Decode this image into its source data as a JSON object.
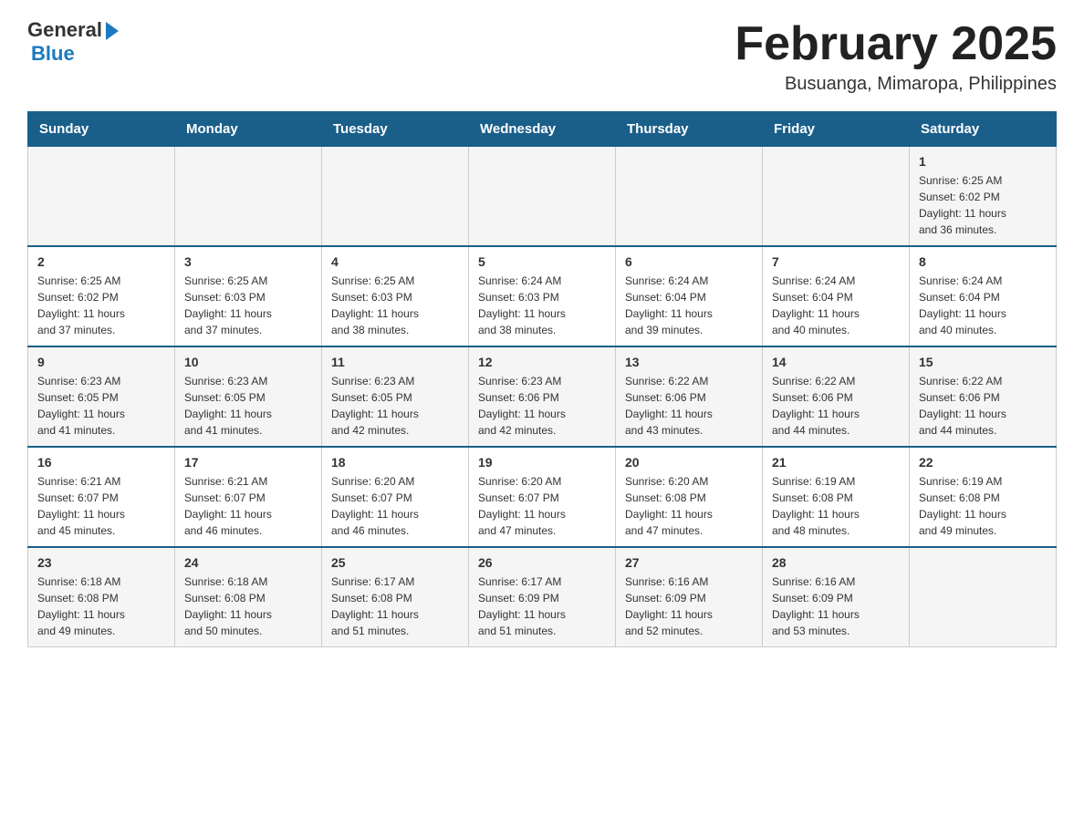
{
  "header": {
    "logo_general": "General",
    "logo_blue": "Blue",
    "month_title": "February 2025",
    "location": "Busuanga, Mimaropa, Philippines"
  },
  "weekdays": [
    "Sunday",
    "Monday",
    "Tuesday",
    "Wednesday",
    "Thursday",
    "Friday",
    "Saturday"
  ],
  "weeks": [
    [
      {
        "day": "",
        "info": ""
      },
      {
        "day": "",
        "info": ""
      },
      {
        "day": "",
        "info": ""
      },
      {
        "day": "",
        "info": ""
      },
      {
        "day": "",
        "info": ""
      },
      {
        "day": "",
        "info": ""
      },
      {
        "day": "1",
        "info": "Sunrise: 6:25 AM\nSunset: 6:02 PM\nDaylight: 11 hours\nand 36 minutes."
      }
    ],
    [
      {
        "day": "2",
        "info": "Sunrise: 6:25 AM\nSunset: 6:02 PM\nDaylight: 11 hours\nand 37 minutes."
      },
      {
        "day": "3",
        "info": "Sunrise: 6:25 AM\nSunset: 6:03 PM\nDaylight: 11 hours\nand 37 minutes."
      },
      {
        "day": "4",
        "info": "Sunrise: 6:25 AM\nSunset: 6:03 PM\nDaylight: 11 hours\nand 38 minutes."
      },
      {
        "day": "5",
        "info": "Sunrise: 6:24 AM\nSunset: 6:03 PM\nDaylight: 11 hours\nand 38 minutes."
      },
      {
        "day": "6",
        "info": "Sunrise: 6:24 AM\nSunset: 6:04 PM\nDaylight: 11 hours\nand 39 minutes."
      },
      {
        "day": "7",
        "info": "Sunrise: 6:24 AM\nSunset: 6:04 PM\nDaylight: 11 hours\nand 40 minutes."
      },
      {
        "day": "8",
        "info": "Sunrise: 6:24 AM\nSunset: 6:04 PM\nDaylight: 11 hours\nand 40 minutes."
      }
    ],
    [
      {
        "day": "9",
        "info": "Sunrise: 6:23 AM\nSunset: 6:05 PM\nDaylight: 11 hours\nand 41 minutes."
      },
      {
        "day": "10",
        "info": "Sunrise: 6:23 AM\nSunset: 6:05 PM\nDaylight: 11 hours\nand 41 minutes."
      },
      {
        "day": "11",
        "info": "Sunrise: 6:23 AM\nSunset: 6:05 PM\nDaylight: 11 hours\nand 42 minutes."
      },
      {
        "day": "12",
        "info": "Sunrise: 6:23 AM\nSunset: 6:06 PM\nDaylight: 11 hours\nand 42 minutes."
      },
      {
        "day": "13",
        "info": "Sunrise: 6:22 AM\nSunset: 6:06 PM\nDaylight: 11 hours\nand 43 minutes."
      },
      {
        "day": "14",
        "info": "Sunrise: 6:22 AM\nSunset: 6:06 PM\nDaylight: 11 hours\nand 44 minutes."
      },
      {
        "day": "15",
        "info": "Sunrise: 6:22 AM\nSunset: 6:06 PM\nDaylight: 11 hours\nand 44 minutes."
      }
    ],
    [
      {
        "day": "16",
        "info": "Sunrise: 6:21 AM\nSunset: 6:07 PM\nDaylight: 11 hours\nand 45 minutes."
      },
      {
        "day": "17",
        "info": "Sunrise: 6:21 AM\nSunset: 6:07 PM\nDaylight: 11 hours\nand 46 minutes."
      },
      {
        "day": "18",
        "info": "Sunrise: 6:20 AM\nSunset: 6:07 PM\nDaylight: 11 hours\nand 46 minutes."
      },
      {
        "day": "19",
        "info": "Sunrise: 6:20 AM\nSunset: 6:07 PM\nDaylight: 11 hours\nand 47 minutes."
      },
      {
        "day": "20",
        "info": "Sunrise: 6:20 AM\nSunset: 6:08 PM\nDaylight: 11 hours\nand 47 minutes."
      },
      {
        "day": "21",
        "info": "Sunrise: 6:19 AM\nSunset: 6:08 PM\nDaylight: 11 hours\nand 48 minutes."
      },
      {
        "day": "22",
        "info": "Sunrise: 6:19 AM\nSunset: 6:08 PM\nDaylight: 11 hours\nand 49 minutes."
      }
    ],
    [
      {
        "day": "23",
        "info": "Sunrise: 6:18 AM\nSunset: 6:08 PM\nDaylight: 11 hours\nand 49 minutes."
      },
      {
        "day": "24",
        "info": "Sunrise: 6:18 AM\nSunset: 6:08 PM\nDaylight: 11 hours\nand 50 minutes."
      },
      {
        "day": "25",
        "info": "Sunrise: 6:17 AM\nSunset: 6:08 PM\nDaylight: 11 hours\nand 51 minutes."
      },
      {
        "day": "26",
        "info": "Sunrise: 6:17 AM\nSunset: 6:09 PM\nDaylight: 11 hours\nand 51 minutes."
      },
      {
        "day": "27",
        "info": "Sunrise: 6:16 AM\nSunset: 6:09 PM\nDaylight: 11 hours\nand 52 minutes."
      },
      {
        "day": "28",
        "info": "Sunrise: 6:16 AM\nSunset: 6:09 PM\nDaylight: 11 hours\nand 53 minutes."
      },
      {
        "day": "",
        "info": ""
      }
    ]
  ]
}
